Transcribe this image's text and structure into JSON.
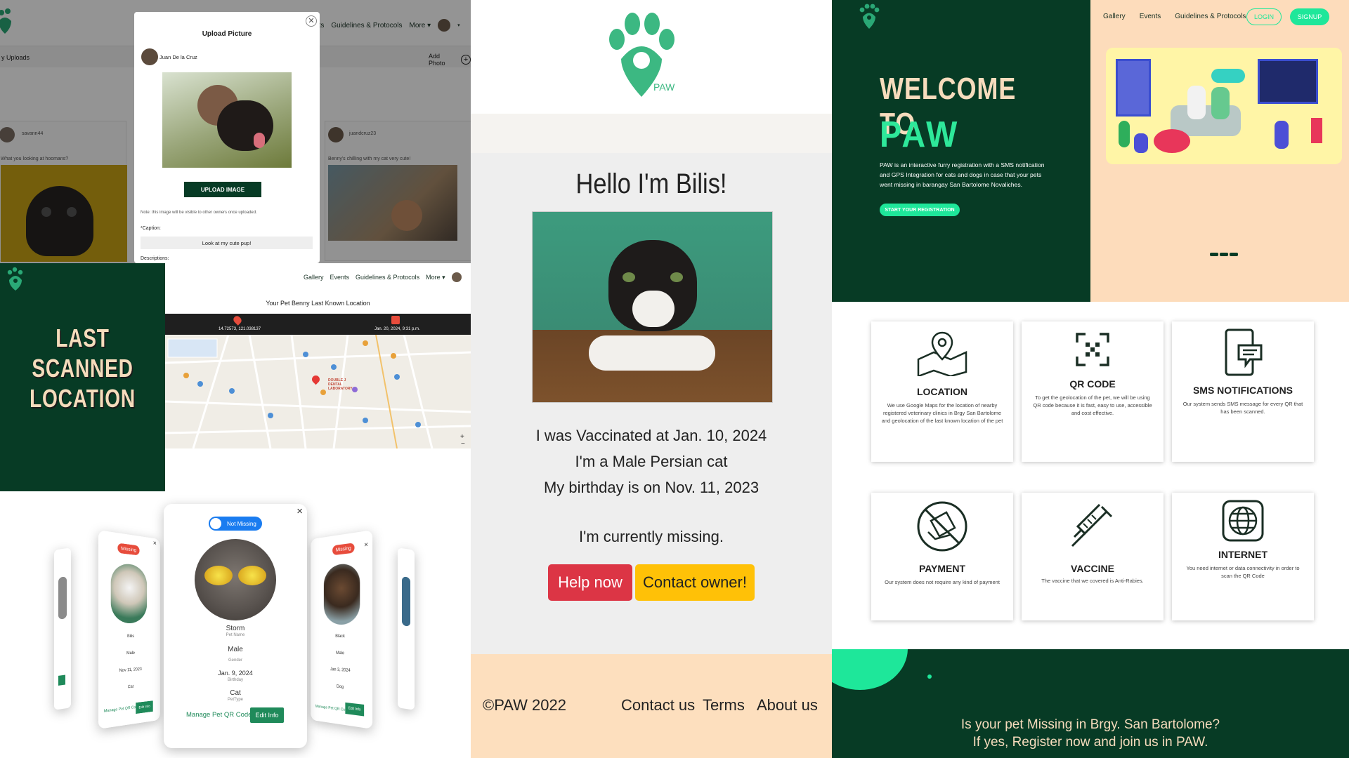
{
  "upload_page": {
    "nav": {
      "links": [
        "Events",
        "Guidelines & Protocols",
        "More"
      ],
      "events_fragment": "nts"
    },
    "subbar": {
      "left": "y Uploads",
      "add_photo": "Add Photo"
    },
    "posts": [
      {
        "user": "savann44",
        "caption": "What you looking at hoomans?"
      },
      {
        "user": "juandcruz23",
        "caption": "Benny's chilling with my cat very cute!"
      }
    ],
    "modal": {
      "title": "Upload Picture",
      "user": "Juan De la Cruz",
      "upload_button": "UPLOAD IMAGE",
      "note": "Note: this image will be visible to other owners once uploaded.",
      "caption_label": "*Caption:",
      "caption_value": "Look at my cute pup!",
      "descriptions_label": "Descriptions:"
    }
  },
  "location_page": {
    "title_lines": [
      "LAST",
      "SCANNED",
      "LOCATION"
    ],
    "nav": {
      "links": [
        "Gallery",
        "Events",
        "Guidelines & Protocols",
        "More"
      ]
    },
    "heading": "Your Pet Benny Last Known Location",
    "coords": "14.72573, 121.038137",
    "datetime": "Jan. 20, 2024, 9:31 p.m.",
    "map_places": [
      "DOUBLE J DENTAL LABORATORY"
    ]
  },
  "carousel": {
    "center": {
      "toggle": "Not Missing",
      "pet_name": "Storm",
      "pet_name_label": "Pet Name",
      "gender": "Male",
      "gender_label": "Gender",
      "birthday": "Jan. 9, 2024",
      "birthday_label": "Birthday",
      "pet_type": "Cat",
      "pet_type_label": "PetType",
      "manage": "Manage Pet QR Code",
      "edit": "Edit Info"
    },
    "left": {
      "status": "Missing",
      "name": "Bilis",
      "gender": "Male",
      "birthday": "Nov 11, 2023",
      "type": "Cat",
      "manage": "Manage Pet QR Code",
      "edit": "Edit Info"
    },
    "right": {
      "status": "Missing",
      "name": "Black",
      "gender": "Male",
      "birthday": "Jan 3, 2024",
      "type": "Dog",
      "manage": "Manage Pet QR Code",
      "edit": "Edit Info"
    }
  },
  "bilis_page": {
    "logo_text": "PAW",
    "greeting": "Hello I'm Bilis!",
    "lines": [
      "I was Vaccinated at Jan. 10, 2024",
      "I'm a Male Persian cat",
      "My birthday is on Nov. 11, 2023"
    ],
    "status": "I'm currently missing.",
    "help_button": "Help now",
    "contact_button": "Contact owner!",
    "footer": {
      "copyright": "©PAW 2022",
      "links": [
        "Contact us",
        "Terms",
        "About us"
      ]
    }
  },
  "landing": {
    "nav": {
      "links": [
        "Gallery",
        "Events",
        "Guidelines & Protocols"
      ],
      "login": "LOGIN",
      "signup": "SIGNUP"
    },
    "welcome": "WELCOME TO",
    "brand": "PAW",
    "description": "PAW is an interactive furry registration with a SMS notification and GPS Integration for cats and dogs in case that your pets went missing in barangay San Bartolome Novaliches.",
    "cta": "START YOUR REGISTRATION"
  },
  "features": [
    {
      "title": "LOCATION",
      "desc": "We use Google Maps for the location of nearby registered veterinary clinics in Brgy San Bartolome and geolocation of the last known location of the pet",
      "icon": "map-pin-icon"
    },
    {
      "title": "QR CODE",
      "desc": "To get the geolocation of the pet, we will be using QR code because it is fast, easy to use, accessible and cost effective.",
      "icon": "qr-scan-icon"
    },
    {
      "title": "SMS NOTIFICATIONS",
      "desc": "Our system sends SMS message for every QR that has been scanned.",
      "icon": "phone-message-icon"
    },
    {
      "title": "PAYMENT",
      "desc": "Our system does not require any kind of payment",
      "icon": "no-payment-icon"
    },
    {
      "title": "VACCINE",
      "desc": "The vaccine that we covered is Anti-Rabies.",
      "icon": "syringe-icon"
    },
    {
      "title": "INTERNET",
      "desc": "You need internet or data connectivity in order to scan the QR Code",
      "icon": "globe-icon"
    }
  ],
  "banner": {
    "line1": "Is your pet Missing in Brgy. San Bartolome?",
    "line2": "If yes, Register now and join us in PAW."
  },
  "colors": {
    "dark_green": "#073b25",
    "accent_green": "#1ee79a",
    "peach": "#fddcbb",
    "red": "#dc3545",
    "yellow": "#ffc107"
  }
}
